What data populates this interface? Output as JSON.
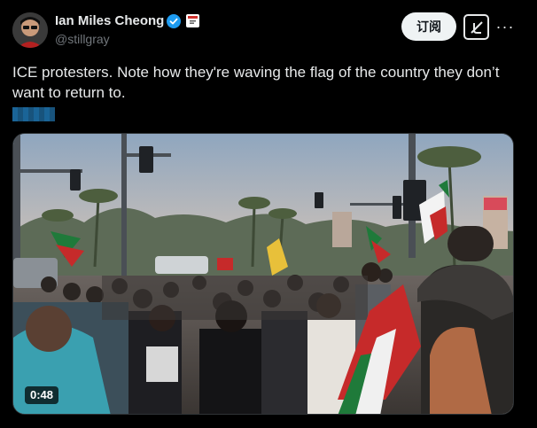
{
  "author": {
    "display_name": "Ian Miles Cheong",
    "handle": "@stillgray",
    "verified": true
  },
  "actions": {
    "subscribe_label": "订阅",
    "grok_icon": "grok-icon",
    "more_label": "···"
  },
  "tweet": {
    "text": "ICE protesters. Note how they're waving the flag of the country they don’t want to return to."
  },
  "media": {
    "type": "video",
    "duration": "0:48"
  },
  "colors": {
    "background": "#000000",
    "text_primary": "#e7e9ea",
    "text_secondary": "#71767b",
    "verified_blue": "#1d9bf0"
  }
}
